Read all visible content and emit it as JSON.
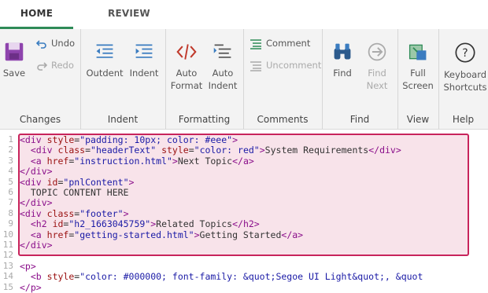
{
  "tabs": {
    "home": "HOME",
    "review": "REVIEW"
  },
  "ribbon": {
    "changes": {
      "label": "Changes",
      "save": "Save",
      "undo": "Undo",
      "redo": "Redo"
    },
    "indent": {
      "label": "Indent",
      "outdent": "Outdent",
      "indent": "Indent"
    },
    "formatting": {
      "label": "Formatting",
      "auto_format": [
        "Auto",
        "Format"
      ],
      "auto_indent": [
        "Auto",
        "Indent"
      ]
    },
    "comments": {
      "label": "Comments",
      "comment": "Comment",
      "uncomment": "Uncomment"
    },
    "find": {
      "label": "Find",
      "find": "Find",
      "find_next": [
        "Find",
        "Next"
      ]
    },
    "view": {
      "label": "View",
      "full_screen": [
        "Full",
        "Screen"
      ]
    },
    "help": {
      "label": "Help",
      "keyboard_shortcuts": [
        "Keyboard",
        "Shortcuts"
      ]
    }
  },
  "editor": {
    "line_numbers": [
      "1",
      "2",
      "3",
      "4",
      "5",
      "6",
      "7",
      "8",
      "9",
      "10",
      "11",
      "12",
      "13",
      "14",
      "15"
    ],
    "lines": [
      [
        [
          "t",
          "<div "
        ],
        [
          "a",
          "style"
        ],
        [
          "x",
          "="
        ],
        [
          "v",
          "\"padding: 10px; color: #eee\""
        ],
        [
          "t",
          ">"
        ]
      ],
      [
        [
          "x",
          "  "
        ],
        [
          "t",
          "<div "
        ],
        [
          "a",
          "class"
        ],
        [
          "x",
          "="
        ],
        [
          "v",
          "\"headerText\""
        ],
        [
          "x",
          " "
        ],
        [
          "a",
          "style"
        ],
        [
          "x",
          "="
        ],
        [
          "v",
          "\"color: red\""
        ],
        [
          "t",
          ">"
        ],
        [
          "x",
          "System Requirements"
        ],
        [
          "t",
          "</div>"
        ]
      ],
      [
        [
          "x",
          "  "
        ],
        [
          "t",
          "<a "
        ],
        [
          "a",
          "href"
        ],
        [
          "x",
          "="
        ],
        [
          "v",
          "\"instruction.html\""
        ],
        [
          "t",
          ">"
        ],
        [
          "x",
          "Next Topic"
        ],
        [
          "t",
          "</a>"
        ]
      ],
      [
        [
          "t",
          "</div>"
        ]
      ],
      [
        [
          "t",
          "<div "
        ],
        [
          "a",
          "id"
        ],
        [
          "x",
          "="
        ],
        [
          "v",
          "\"pnlContent\""
        ],
        [
          "t",
          ">"
        ]
      ],
      [
        [
          "x",
          "  TOPIC CONTENT HERE"
        ]
      ],
      [
        [
          "t",
          "</div>"
        ]
      ],
      [
        [
          "t",
          "<div "
        ],
        [
          "a",
          "class"
        ],
        [
          "x",
          "="
        ],
        [
          "v",
          "\"footer\""
        ],
        [
          "t",
          ">"
        ]
      ],
      [
        [
          "x",
          "  "
        ],
        [
          "t",
          "<h2 "
        ],
        [
          "a",
          "id"
        ],
        [
          "x",
          "="
        ],
        [
          "v",
          "\"h2_1663045759\""
        ],
        [
          "t",
          ">"
        ],
        [
          "x",
          "Related Topics"
        ],
        [
          "t",
          "</h2>"
        ]
      ],
      [
        [
          "x",
          "  "
        ],
        [
          "t",
          "<a "
        ],
        [
          "a",
          "href"
        ],
        [
          "x",
          "="
        ],
        [
          "v",
          "\"getting-started.html\""
        ],
        [
          "t",
          ">"
        ],
        [
          "x",
          "Getting Started"
        ],
        [
          "t",
          "</a>"
        ]
      ],
      [
        [
          "t",
          "</div>"
        ]
      ],
      [
        [
          "x",
          ""
        ]
      ],
      [
        [
          "t",
          "<p>"
        ]
      ],
      [
        [
          "x",
          "  "
        ],
        [
          "t",
          "<b "
        ],
        [
          "a",
          "style"
        ],
        [
          "x",
          "="
        ],
        [
          "v",
          "\"color: #000000; font-family: &quot;Segoe UI Light&quot;, &quot"
        ]
      ],
      [
        [
          "t",
          "</p>"
        ]
      ]
    ]
  }
}
